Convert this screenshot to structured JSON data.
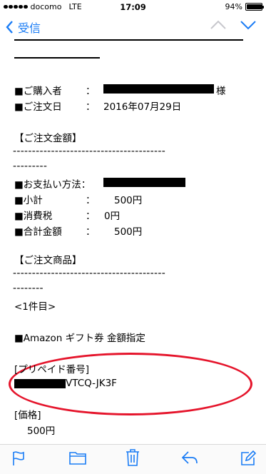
{
  "status": {
    "carrier": "docomo",
    "network": "LTE",
    "time": "17:09",
    "battery": "94%",
    "battery_level": 0.94
  },
  "nav": {
    "back_label": "受信"
  },
  "email": {
    "buyer_label": "■ご購入者",
    "buyer_suffix": "様",
    "order_date_label": "■ご注文日",
    "order_date": "2016年07月29日",
    "amount_heading": "【ご注文金額】",
    "dash_long": "----------------------------------------",
    "dash_short1": "---------",
    "payment_label": "■お支払い方法：",
    "subtotal_label": "■小計",
    "subtotal_value": "500円",
    "tax_label": "■消費税",
    "tax_value": "0円",
    "total_label": "■合計金額",
    "total_value": "500円",
    "items_heading": "【ご注文商品】",
    "dash_short2": "--------",
    "item_count": "<1件目>",
    "product": "■Amazon ギフト券 金額指定",
    "prepaid_heading": "[プリペイド番号]",
    "prepaid_code_visible": "VTCQ-JK3F",
    "price_heading": "[価格]",
    "price_value": "500円",
    "colon": "："
  }
}
